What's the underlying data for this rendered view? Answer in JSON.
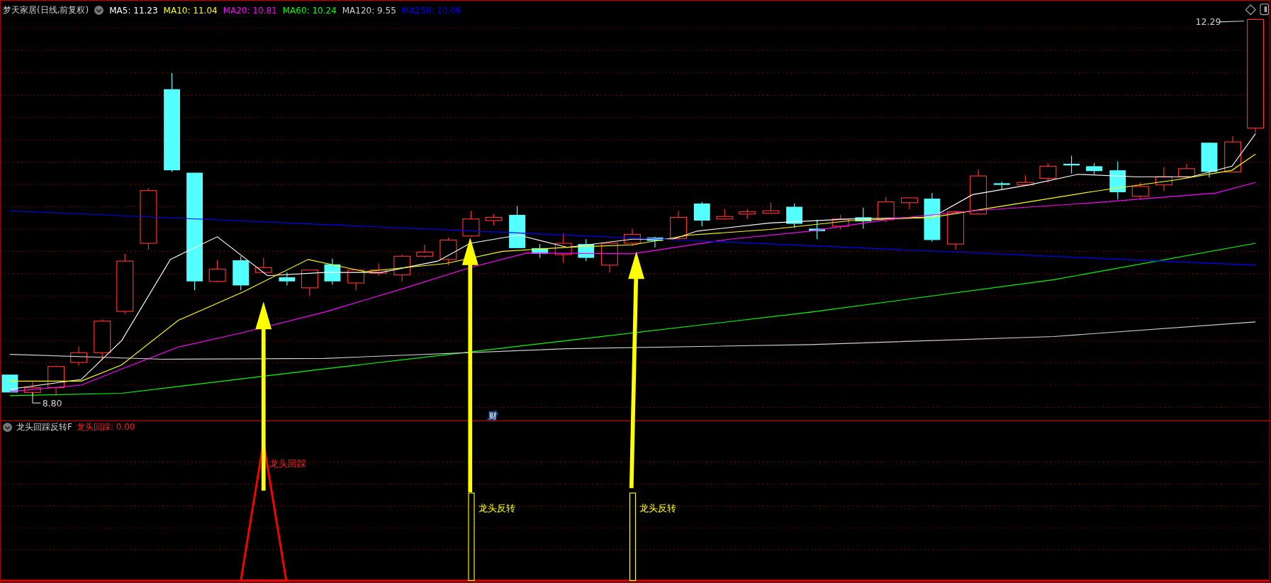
{
  "main_panel": {
    "title": "梦天家居(日线,前复权)",
    "indicators": [
      {
        "label": "MA5: 11.23",
        "color": "#ffffff"
      },
      {
        "label": "MA10: 11.04",
        "color": "#ffff00"
      },
      {
        "label": "MA20: 10.81",
        "color": "#ff00ff"
      },
      {
        "label": "MA60: 10.24",
        "color": "#00ff00"
      },
      {
        "label": "MA120: 9.55",
        "color": "#d0d0d0"
      },
      {
        "label": "MA250: 10.06",
        "color": "#0000ff"
      }
    ],
    "high_label": "12.29",
    "low_label": "8.80",
    "finance_badge": "财"
  },
  "indicator_panel": {
    "title": "龙头回踩反转F",
    "value_label": "龙头回踩: 0.00",
    "signals": [
      {
        "kind": "pullback",
        "label": "龙头回踩"
      },
      {
        "kind": "reversal",
        "label": "龙头反转"
      },
      {
        "kind": "reversal",
        "label": "龙头反转"
      }
    ]
  }
}
